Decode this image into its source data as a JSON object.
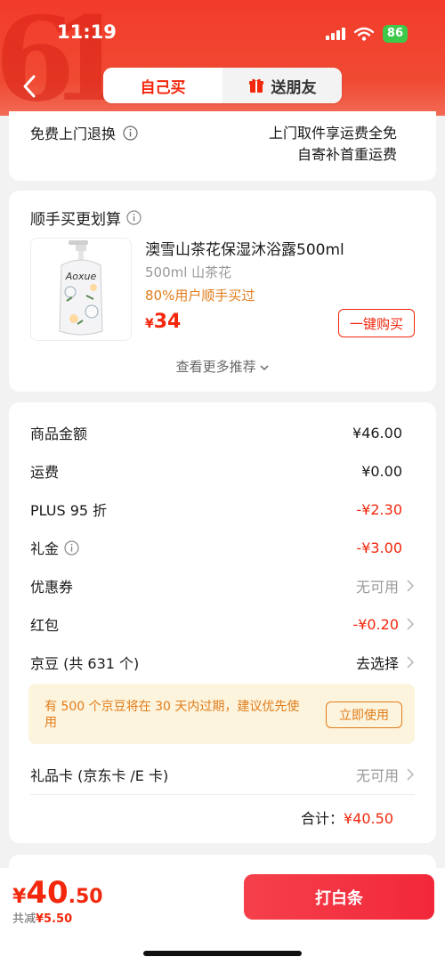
{
  "status_bar": {
    "time": "11:19",
    "battery": "86"
  },
  "header": {
    "tabs": [
      {
        "label": "自己买",
        "active": true
      },
      {
        "label": "送朋友",
        "active": false
      }
    ]
  },
  "delivery": {
    "label": "免费上门退换",
    "line1": "上门取件享运费全免",
    "line2": "自寄补首重运费"
  },
  "recommend": {
    "title": "顺手买更划算",
    "product": {
      "name": "澳雪山茶花保湿沐浴露500ml",
      "spec": "500ml 山茶花",
      "note": "80%用户顺手买过",
      "currency": "¥",
      "price": "34",
      "buy_label": "一键购买",
      "bottle_brand": "Aoxue"
    },
    "more_label": "查看更多推荐"
  },
  "summary": {
    "rows": [
      {
        "label": "商品金额",
        "value": "¥46.00"
      },
      {
        "label": "运费",
        "value": "¥0.00"
      },
      {
        "label": "PLUS 95 折",
        "value": "-¥2.30"
      },
      {
        "label": "礼金",
        "value": "-¥3.00"
      },
      {
        "label": "优惠券",
        "value": "无可用"
      },
      {
        "label": "红包",
        "value": "-¥0.20"
      },
      {
        "label": "京豆 (共 631 个)",
        "value": "去选择"
      }
    ],
    "notice": {
      "text": "有 500 个京豆将在 30 天内过期，建议优先使用",
      "button": "立即使用"
    },
    "giftcard": {
      "label": "礼品卡 (京东卡 /E 卡)",
      "value": "无可用"
    },
    "total_label": "合计：",
    "total_value": "¥40.50"
  },
  "bottom_bar": {
    "currency": "¥",
    "price_int": "40",
    "price_dec": ".50",
    "save_label": "共减",
    "save_value": "¥5.50",
    "pay_label": "打白条"
  },
  "colors": {
    "brand_red": "#f2270c",
    "header_red": "#f33b2b",
    "notice_orange": "#e07c1b",
    "notice_bg": "#fdf4dd"
  },
  "icons": [
    "back-icon",
    "gift-icon",
    "info-icon",
    "chevron-down-icon",
    "chevron-right-icon",
    "signal-icon",
    "wifi-icon",
    "battery-icon"
  ]
}
